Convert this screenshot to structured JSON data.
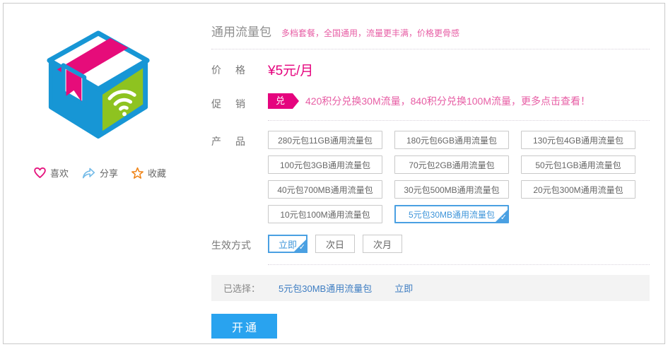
{
  "product": {
    "title": "通用流量包",
    "subtitle": "多档套餐，全国通用，流量更丰满，价格更骨感",
    "price_label": "价格",
    "price_value": "¥5元/月",
    "promo_label": "促销",
    "promo_badge": "兑",
    "promo_text": "420积分兑换30M流量，840积分兑换100M流量，更多点击查看！",
    "products_label": "产品",
    "effect_label": "生效方式"
  },
  "packages": [
    {
      "label": "280元包11GB通用流量包",
      "selected": false
    },
    {
      "label": "180元包6GB通用流量包",
      "selected": false
    },
    {
      "label": "130元包4GB通用流量包",
      "selected": false
    },
    {
      "label": "100元包3GB通用流量包",
      "selected": false
    },
    {
      "label": "70元包2GB通用流量包",
      "selected": false
    },
    {
      "label": "50元包1GB通用流量包",
      "selected": false
    },
    {
      "label": "40元包700MB通用流量包",
      "selected": false
    },
    {
      "label": "30元包500MB通用流量包",
      "selected": false
    },
    {
      "label": "20元包300M通用流量包",
      "selected": false
    },
    {
      "label": "10元包100M通用流量包",
      "selected": false
    },
    {
      "label": "5元包30MB通用流量包",
      "selected": true
    }
  ],
  "effects": [
    {
      "label": "立即",
      "selected": true
    },
    {
      "label": "次日",
      "selected": false
    },
    {
      "label": "次月",
      "selected": false
    }
  ],
  "actions": {
    "like": "喜欢",
    "share": "分享",
    "favorite": "收藏"
  },
  "summary": {
    "label": "已选择：",
    "package": "5元包30MB通用流量包",
    "effect": "立即"
  },
  "activate_label": "开通",
  "icons": {
    "check": "✓"
  },
  "colors": {
    "primary_pink": "#e5047e",
    "light_pink_text": "#e75da4",
    "selected_blue": "#4aa0e2",
    "selected_blue_text": "#3d94d9",
    "activate_blue": "#29a3ef",
    "link_blue": "#3e7dc2",
    "box_blue": "#1796d5",
    "box_green": "#8ec320",
    "star_orange": "#f08519"
  }
}
